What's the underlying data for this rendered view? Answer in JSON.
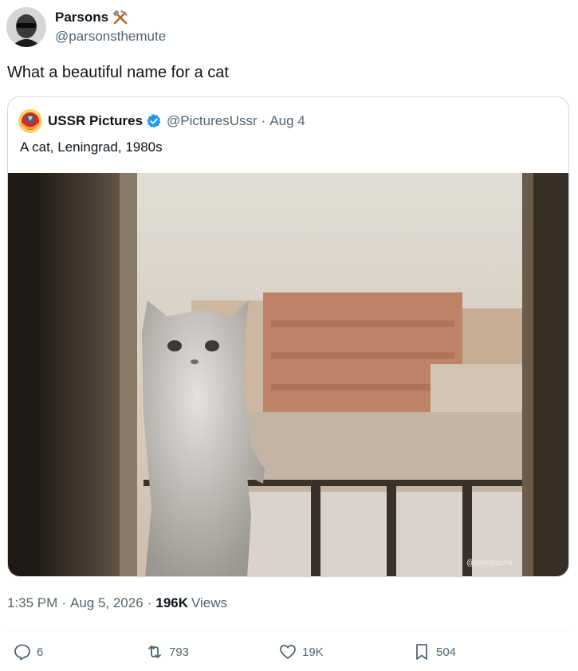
{
  "author": {
    "display_name": "Parsons",
    "handle": "@parsonsthemute",
    "badge_icon": "hammer-and-pick-icon"
  },
  "tweet": {
    "text": "What a beautiful name for a cat"
  },
  "quoted": {
    "display_name": "USSR Pictures",
    "handle": "@PicturesUssr",
    "dot": "·",
    "date": "Aug 4",
    "text": "A cat, Leningrad, 1980s",
    "photo_watermark": "@retrodasha"
  },
  "meta": {
    "time": "1:35 PM",
    "sep": "·",
    "date": "Aug 5, 2026",
    "views_count": "196K",
    "views_label": "Views"
  },
  "actions": {
    "replies": "6",
    "reposts": "793",
    "likes": "19K",
    "bookmarks": "504"
  },
  "colors": {
    "text": "#0f1419",
    "secondary": "#536471",
    "verified": "#1d9bf0",
    "border": "#cfd9de"
  }
}
